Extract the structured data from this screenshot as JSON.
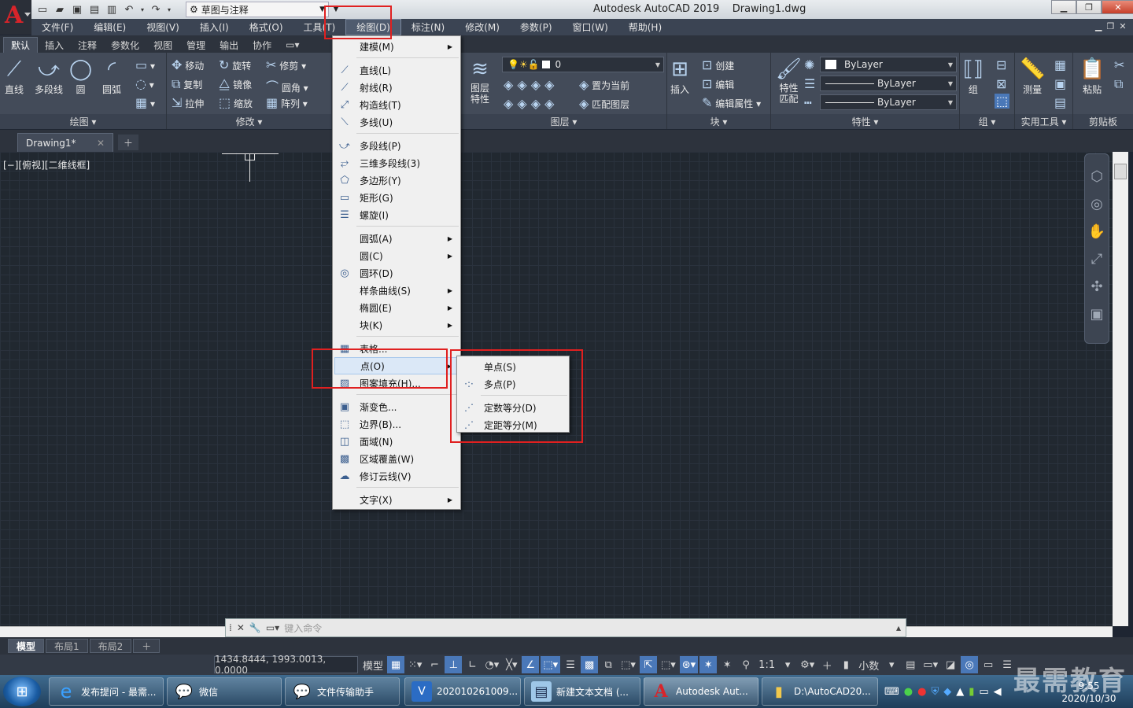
{
  "app": {
    "title": "Autodesk AutoCAD 2019",
    "document": "Drawing1.dwg"
  },
  "qat": {
    "workspace": "草图与注释"
  },
  "menubar": [
    "文件(F)",
    "编辑(E)",
    "视图(V)",
    "插入(I)",
    "格式(O)",
    "工具(T)",
    "绘图(D)",
    "标注(N)",
    "修改(M)",
    "参数(P)",
    "窗口(W)",
    "帮助(H)"
  ],
  "ribbon_tabs": [
    "默认",
    "插入",
    "注释",
    "参数化",
    "视图",
    "管理",
    "输出",
    "协作"
  ],
  "ribbon": {
    "draw": {
      "title": "绘图",
      "line": "直线",
      "polyline": "多段线",
      "circle": "圆",
      "arc": "圆弧"
    },
    "modify": {
      "title": "修改",
      "move": "移动",
      "rotate": "旋转",
      "trim": "修剪",
      "copy": "复制",
      "mirror": "镜像",
      "fillet": "圆角",
      "stretch": "拉伸",
      "scale": "缩放",
      "array": "阵列"
    },
    "layers": {
      "title": "图层",
      "props": "图层\n特性",
      "current_layer": "0",
      "set_current": "置为当前",
      "match_layer": "匹配图层"
    },
    "block": {
      "title": "块",
      "insert": "插入",
      "create": "创建",
      "edit": "编辑",
      "edit_attr": "编辑属性"
    },
    "properties": {
      "title": "特性",
      "match": "特性\n匹配",
      "color": "ByLayer",
      "linetype": "ByLayer",
      "lineweight": "ByLayer"
    },
    "groups": {
      "title": "组",
      "group": "组"
    },
    "utilities": {
      "title": "实用工具",
      "measure": "测量"
    },
    "clipboard": {
      "title": "剪贴板",
      "paste": "粘贴"
    }
  },
  "doc_tab": {
    "name": "Drawing1*"
  },
  "viewport_label": "[−][俯视][二维线框]",
  "draw_menu": [
    {
      "label": "建模(M)",
      "sub": true
    },
    {
      "label": "直线(L)"
    },
    {
      "label": "射线(R)"
    },
    {
      "label": "构造线(T)"
    },
    {
      "label": "多线(U)"
    },
    {
      "label": "多段线(P)"
    },
    {
      "label": "三维多段线(3)"
    },
    {
      "label": "多边形(Y)"
    },
    {
      "label": "矩形(G)"
    },
    {
      "label": "螺旋(I)"
    },
    {
      "label": "圆弧(A)",
      "sub": true
    },
    {
      "label": "圆(C)",
      "sub": true
    },
    {
      "label": "圆环(D)"
    },
    {
      "label": "样条曲线(S)",
      "sub": true
    },
    {
      "label": "椭圆(E)",
      "sub": true
    },
    {
      "label": "块(K)",
      "sub": true
    },
    {
      "label": "表格..."
    },
    {
      "label": "点(O)",
      "sub": true
    },
    {
      "label": "图案填充(H)..."
    },
    {
      "label": "渐变色..."
    },
    {
      "label": "边界(B)..."
    },
    {
      "label": "面域(N)"
    },
    {
      "label": "区域覆盖(W)"
    },
    {
      "label": "修订云线(V)"
    },
    {
      "label": "文字(X)",
      "sub": true
    }
  ],
  "point_menu": [
    "单点(S)",
    "多点(P)",
    "定数等分(D)",
    "定距等分(M)"
  ],
  "command_line": {
    "placeholder": "键入命令"
  },
  "layout_tabs": [
    "模型",
    "布局1",
    "布局2"
  ],
  "status": {
    "coords": "1434.8444, 1993.0013, 0.0000",
    "model": "模型",
    "scale": "1:1",
    "units": "小数"
  },
  "taskbar": [
    {
      "label": "发布提问 - 最需..."
    },
    {
      "label": "微信"
    },
    {
      "label": "文件传输助手"
    },
    {
      "label": "202010261009..."
    },
    {
      "label": "新建文本文档 (..."
    },
    {
      "label": "Autodesk Aut..."
    },
    {
      "label": "D:\\AutoCAD20..."
    }
  ],
  "clock": {
    "time": "9:55",
    "date": "2020/10/30"
  },
  "watermark": "最需教育",
  "colors": {
    "accent": "#4a78b8",
    "highlight_box": "#e02020",
    "canvas": "#212830"
  }
}
